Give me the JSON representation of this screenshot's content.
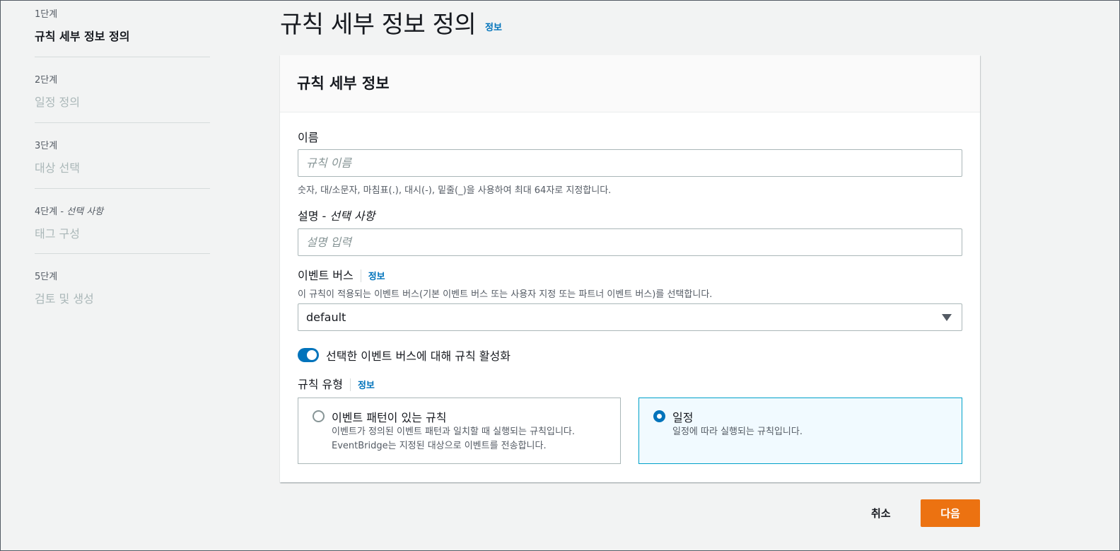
{
  "wizard": {
    "steps": [
      {
        "number": "1단계",
        "title": "규칙 세부 정보 정의"
      },
      {
        "number": "2단계",
        "title": "일정 정의"
      },
      {
        "number": "3단계",
        "title": "대상 선택"
      },
      {
        "number": "4단계",
        "number_optional": "선택 사항",
        "title": "태그 구성"
      },
      {
        "number": "5단계",
        "title": "검토 및 생성"
      }
    ]
  },
  "page": {
    "title": "규칙 세부 정보 정의",
    "info_label": "정보"
  },
  "panel": {
    "title": "규칙 세부 정보",
    "name": {
      "label": "이름",
      "placeholder": "규칙 이름",
      "value": "",
      "hint": "숫자, 대/소문자, 마침표(.), 대시(-), 밑줄(_)을 사용하여 최대 64자로 지정합니다."
    },
    "description": {
      "label": "설명 -",
      "label_optional": "선택 사항",
      "placeholder": "설명 입력",
      "value": ""
    },
    "event_bus": {
      "label": "이벤트 버스",
      "info_label": "정보",
      "hint": "이 규칙이 적용되는 이벤트 버스(기본 이벤트 버스 또는 사용자 지정 또는 파트너 이벤트 버스)를 선택합니다.",
      "selected": "default"
    },
    "enable_toggle": {
      "label": "선택한 이벤트 버스에 대해 규칙 활성화",
      "on": true
    },
    "rule_type": {
      "label": "규칙 유형",
      "info_label": "정보",
      "options": [
        {
          "title": "이벤트 패턴이 있는 규칙",
          "desc1": "이벤트가 정의된 이벤트 패턴과 일치할 때 실행되는 규칙입니다.",
          "desc2": "EventBridge는 지정된 대상으로 이벤트를 전송합니다.",
          "selected": false
        },
        {
          "title": "일정",
          "desc1": "일정에 따라 실행되는 규칙입니다.",
          "selected": true
        }
      ]
    }
  },
  "footer": {
    "cancel_label": "취소",
    "next_label": "다음"
  },
  "colors": {
    "accent": "#0073bb",
    "primary_button": "#ec7211",
    "selected_tile_border": "#00a1c9"
  }
}
